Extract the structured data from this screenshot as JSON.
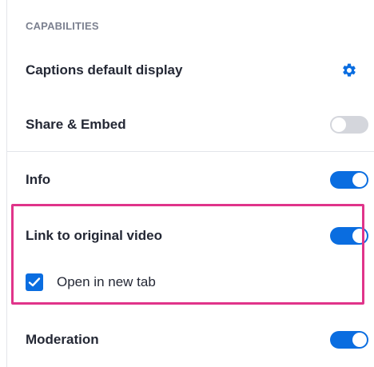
{
  "section": {
    "title": "CAPABILITIES"
  },
  "items": [
    {
      "label": "Captions default display",
      "control": "gear-icon"
    },
    {
      "label": "Share & Embed",
      "control": "toggle",
      "enabled": false
    },
    {
      "label": "Info",
      "control": "toggle",
      "enabled": true
    },
    {
      "label": "Link to original video",
      "control": "toggle",
      "enabled": true
    },
    {
      "label": "Moderation",
      "control": "toggle",
      "enabled": true
    }
  ],
  "sub_option": {
    "label": "Open in new tab",
    "checked": true
  },
  "colors": {
    "accent": "#0a6de0",
    "toggle_off": "#d4d6dc",
    "highlight": "#e0348a",
    "section_title": "#7c8190"
  }
}
